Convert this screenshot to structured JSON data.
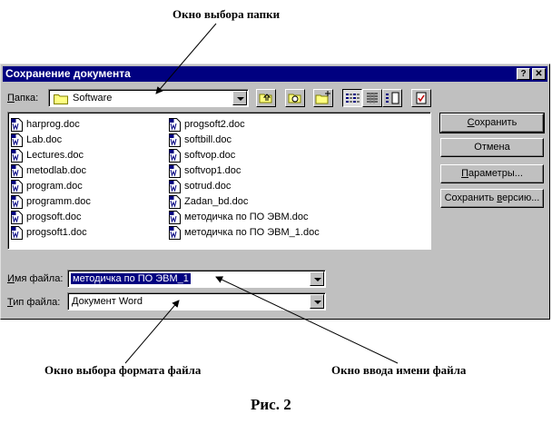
{
  "annotations": {
    "folder_window": "Окно выбора папки",
    "format_window": "Окно выбора формата файла",
    "filename_window": "Окно ввода имени файла",
    "caption": "Рис. 2"
  },
  "dialog": {
    "title": "Сохранение документа",
    "help_glyph": "?",
    "close_glyph": "✕"
  },
  "folder": {
    "label_u": "П",
    "label_rest": "апка:",
    "value": "Software"
  },
  "files": [
    {
      "name": "harprog.doc"
    },
    {
      "name": "Lab.doc"
    },
    {
      "name": "Lectures.doc"
    },
    {
      "name": "metodlab.doc"
    },
    {
      "name": "program.doc"
    },
    {
      "name": "programm.doc"
    },
    {
      "name": "progsoft.doc"
    },
    {
      "name": "progsoft1.doc"
    },
    {
      "name": "progsoft2.doc"
    },
    {
      "name": "softbill.doc"
    },
    {
      "name": "softvop.doc"
    },
    {
      "name": "softvop1.doc"
    },
    {
      "name": "sotrud.doc"
    },
    {
      "name": "Zadan_bd.doc"
    },
    {
      "name": "методичка по ПО ЭВМ.doc"
    },
    {
      "name": "методичка по ПО ЭВМ_1.doc"
    }
  ],
  "buttons": {
    "save_u": "С",
    "save_rest": "охранить",
    "cancel": "Отмена",
    "params_u": "П",
    "params_rest": "араметры...",
    "save_version_pre": "Сохранить ",
    "save_version_u": "в",
    "save_version_rest": "ерсию..."
  },
  "filename": {
    "label_u": "И",
    "label_rest": "мя файла:",
    "value": "методичка по ПО ЭВМ_1"
  },
  "filetype": {
    "label_u": "Т",
    "label_rest": "ип файла:",
    "value": "Документ Word"
  },
  "icons": {
    "folder_combo": "folder-icon",
    "up": "up-one-level-icon",
    "favorites": "search-web-icon",
    "new_folder": "new-folder-icon",
    "list_view": "list-view-icon",
    "details_view": "details-view-icon",
    "properties_view": "properties-view-icon",
    "tools": "tools-icon",
    "doc": "word-document-icon"
  },
  "colors": {
    "titlebar": "#000080",
    "dialog_bg": "#c0c0c0",
    "selection": "#000080"
  }
}
